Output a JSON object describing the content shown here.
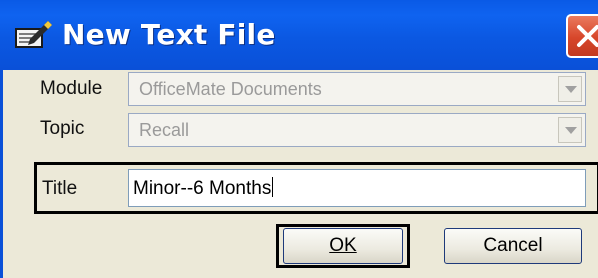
{
  "window": {
    "title": "New Text File",
    "close_icon": "close-icon",
    "app_icon": "notepad-pencil-icon"
  },
  "form": {
    "module": {
      "label": "Module",
      "value": "OfficeMate Documents",
      "enabled": false
    },
    "topic": {
      "label": "Topic",
      "value": "Recall",
      "enabled": false
    },
    "title": {
      "label": "Title",
      "value": "Minor--6 Months"
    }
  },
  "buttons": {
    "ok": "OK",
    "cancel": "Cancel"
  },
  "colors": {
    "titlebar": "#0a5ae6",
    "close": "#d7462a",
    "client_bg": "#ece9d8"
  }
}
